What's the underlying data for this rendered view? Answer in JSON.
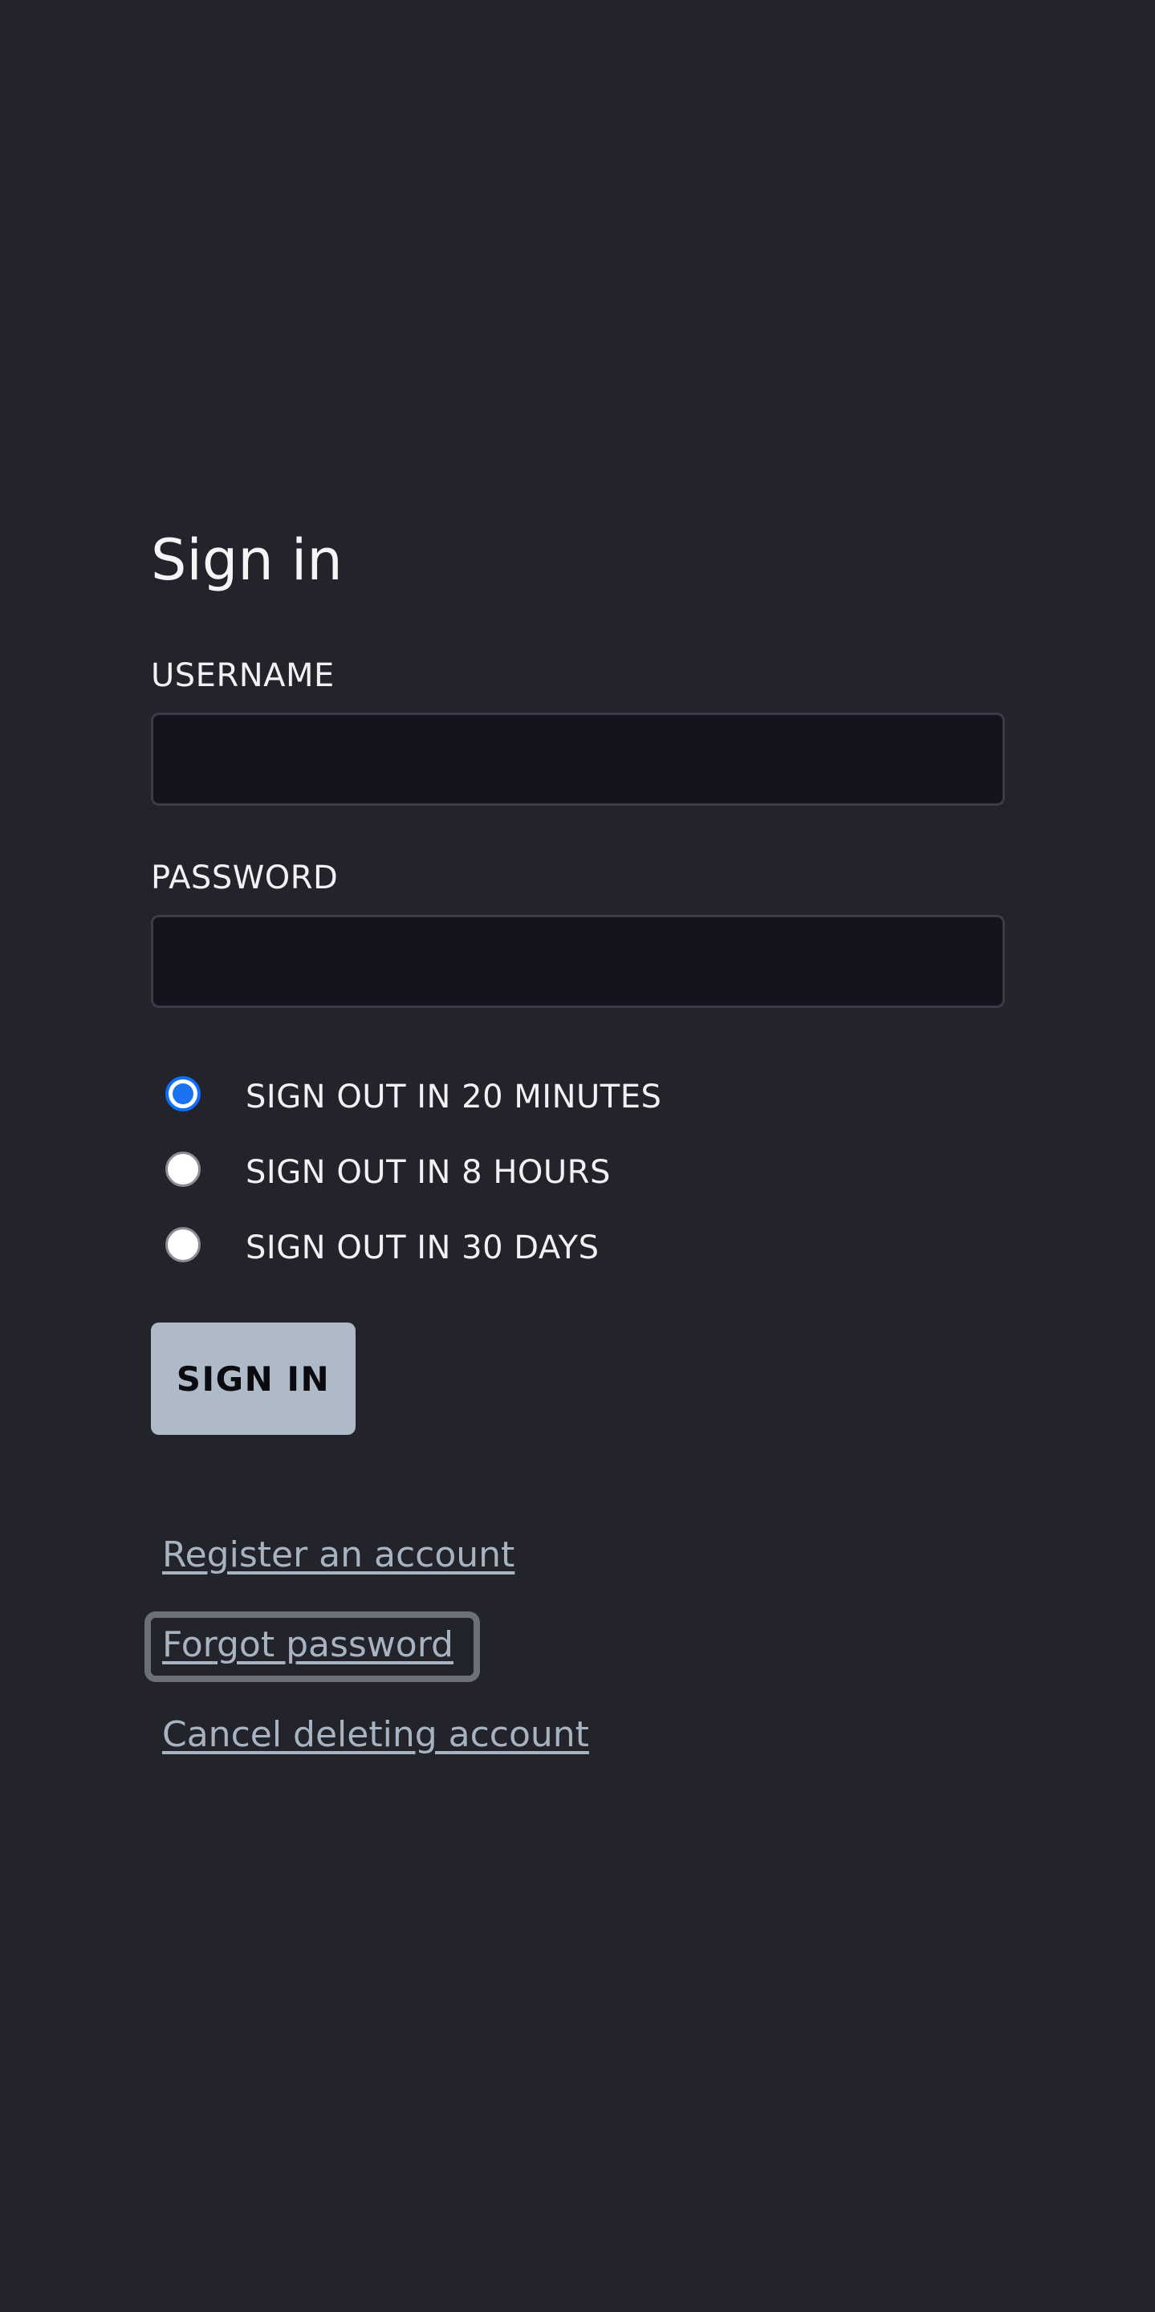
{
  "page": {
    "title": "Sign in"
  },
  "form": {
    "username_label": "USERNAME",
    "username_value": "",
    "password_label": "PASSWORD",
    "password_value": "",
    "session_options": [
      {
        "label": "SIGN OUT IN 20 MINUTES",
        "selected": true
      },
      {
        "label": "SIGN OUT IN 8 HOURS",
        "selected": false
      },
      {
        "label": "SIGN OUT IN 30 DAYS",
        "selected": false
      }
    ],
    "submit_label": "SIGN IN"
  },
  "links": {
    "register": "Register an account",
    "forgot_password": "Forgot password",
    "cancel_delete": "Cancel deleting account"
  },
  "colors": {
    "background": "#22232b",
    "input_background": "#13141d",
    "button_background": "#aebac7",
    "link": "#a8b3c2",
    "radio_accent": "#1a73f0"
  }
}
